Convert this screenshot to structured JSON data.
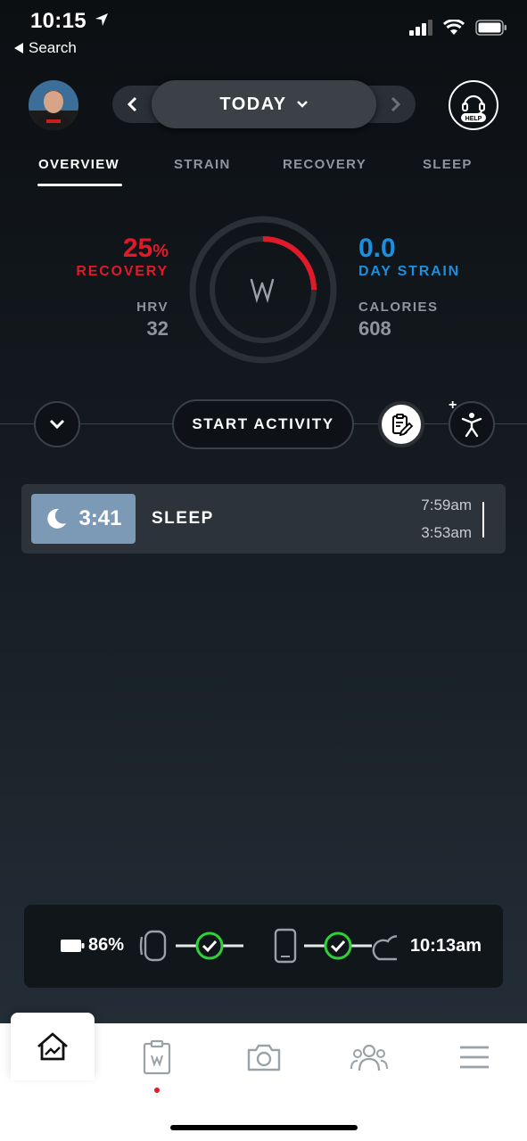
{
  "status_bar": {
    "time": "10:15",
    "back_label": "Search"
  },
  "header": {
    "date_label": "TODAY",
    "help_label": "HELP"
  },
  "tabs": [
    {
      "label": "OVERVIEW",
      "active": true
    },
    {
      "label": "STRAIN",
      "active": false
    },
    {
      "label": "RECOVERY",
      "active": false
    },
    {
      "label": "SLEEP",
      "active": false
    }
  ],
  "overview": {
    "recovery_value": "25",
    "recovery_unit": "%",
    "recovery_label": "RECOVERY",
    "recovery_fraction": 0.25,
    "hrv_label": "HRV",
    "hrv_value": "32",
    "strain_value": "0.0",
    "strain_label": "DAY STRAIN",
    "calories_label": "CALORIES",
    "calories_value": "608"
  },
  "actions": {
    "start_activity": "START ACTIVITY",
    "add_symbol": "+"
  },
  "sleep_entry": {
    "duration": "3:41",
    "title": "SLEEP",
    "end_time": "7:59am",
    "start_time": "3:53am"
  },
  "sync": {
    "battery": "86%",
    "last_sync": "10:13am"
  },
  "colors": {
    "recovery": "#e01a29",
    "strain": "#1b8fe0",
    "sleep": "#7c9ab5",
    "sync_ok": "#2fd13a"
  },
  "nav": {
    "items": [
      "home-icon",
      "journal-icon",
      "camera-icon",
      "community-icon",
      "menu-icon"
    ]
  }
}
